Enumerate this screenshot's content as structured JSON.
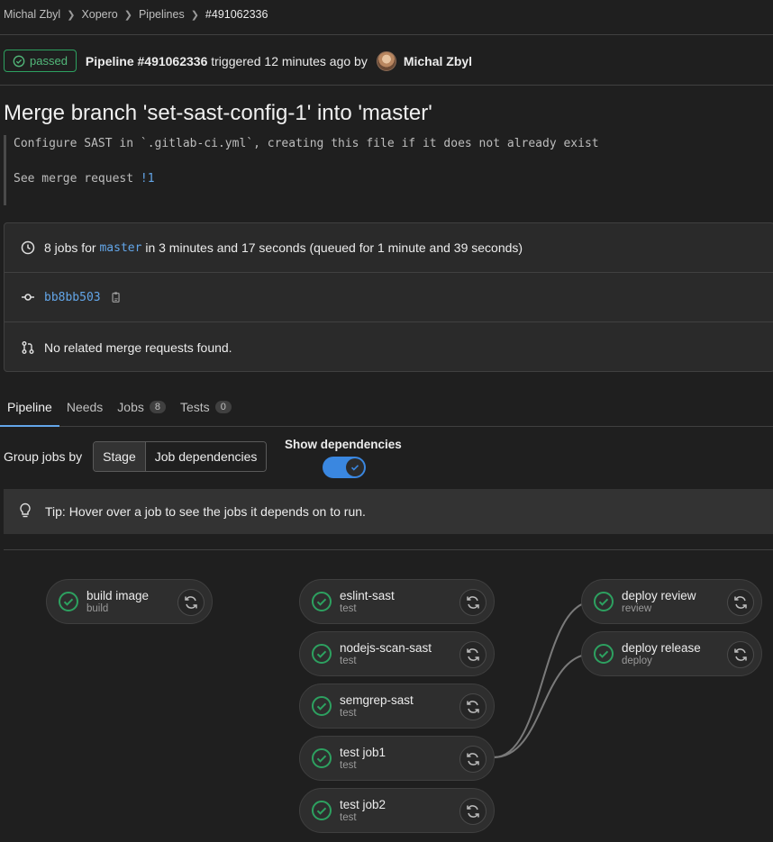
{
  "breadcrumb": [
    "Michal Zbyl",
    "Xopero",
    "Pipelines",
    "#491062336"
  ],
  "status": "passed",
  "header": {
    "pipeline": "Pipeline #491062336",
    "triggered": "triggered",
    "time": "12 minutes ago",
    "by": "by",
    "author": "Michal Zbyl"
  },
  "title": "Merge branch 'set-sast-config-1' into 'master'",
  "commit_desc": {
    "line1": "Configure SAST in `.gitlab-ci.yml`, creating this file if it does not already exist",
    "line2_prefix": "See merge request ",
    "mr_link": "!1"
  },
  "info": {
    "jobs_prefix": "8 jobs for ",
    "branch": "master",
    "jobs_suffix": " in 3 minutes and 17 seconds (queued for 1 minute and 39 seconds)",
    "commit": "bb8bb503",
    "mr_text": "No related merge requests found."
  },
  "tabs": [
    {
      "label": "Pipeline"
    },
    {
      "label": "Needs"
    },
    {
      "label": "Jobs",
      "count": "8"
    },
    {
      "label": "Tests",
      "count": "0"
    }
  ],
  "group": {
    "label": "Group jobs by",
    "stage": "Stage",
    "deps": "Job dependencies",
    "show_deps": "Show dependencies",
    "show_deps_on": true
  },
  "tip": "Tip: Hover over a job to see the jobs it depends on to run.",
  "jobs": [
    {
      "name": "build image",
      "stage": "build"
    },
    {
      "name": "eslint-sast",
      "stage": "test"
    },
    {
      "name": "nodejs-scan-sast",
      "stage": "test"
    },
    {
      "name": "semgrep-sast",
      "stage": "test"
    },
    {
      "name": "test job1",
      "stage": "test"
    },
    {
      "name": "test job2",
      "stage": "test"
    },
    {
      "name": "deploy review",
      "stage": "review"
    },
    {
      "name": "deploy release",
      "stage": "deploy"
    }
  ],
  "colors": {
    "success": "#2da160",
    "link": "#63a6e9",
    "toggle": "#3a87e0"
  },
  "icons": [
    "chevron-right-icon",
    "check-circle-icon",
    "clock-icon",
    "commit-icon",
    "copy-icon",
    "merge-request-icon",
    "lightbulb-icon",
    "retry-icon"
  ]
}
